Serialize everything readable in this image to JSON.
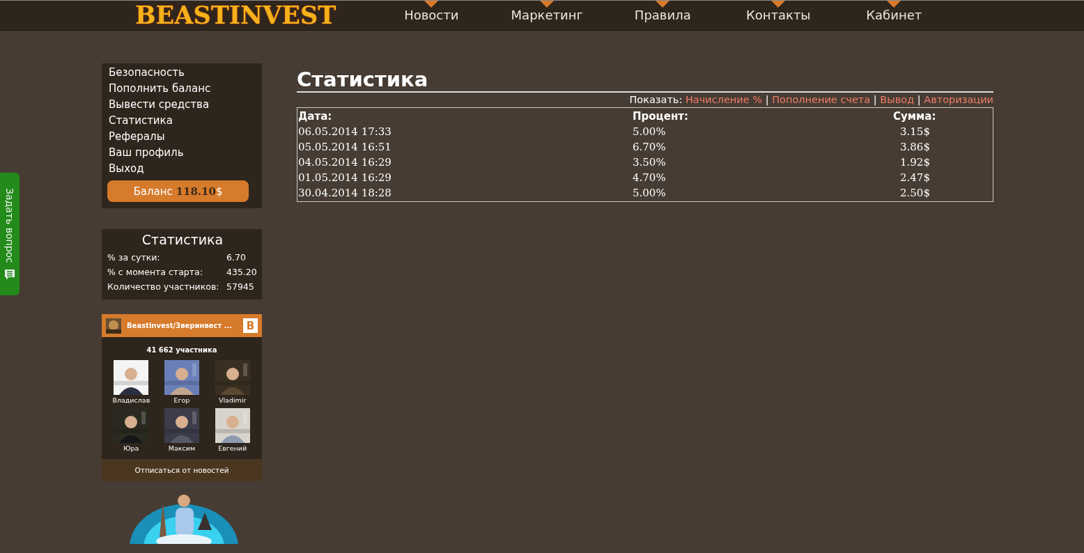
{
  "header": {
    "logo": "BEASTINVEST",
    "nav": [
      {
        "label": "Новости"
      },
      {
        "label": "Маркетинг"
      },
      {
        "label": "Правила"
      },
      {
        "label": "Контакты"
      },
      {
        "label": "Кабинет"
      }
    ]
  },
  "side_tab": {
    "label": "Задать вопрос"
  },
  "account_menu": {
    "items": [
      "Безопасность",
      "Пополнить баланс",
      "Вывести средства",
      "Статистика",
      "Рефералы",
      "Ваш профиль",
      "Выход"
    ],
    "balance_label": "Баланс",
    "balance_value": "118.10",
    "balance_currency": "$"
  },
  "stats_box": {
    "title": "Статистика",
    "rows": [
      {
        "label": "% за сутки:",
        "value": "6.70"
      },
      {
        "label": "% с момента старта:",
        "value": "435.20"
      },
      {
        "label": "Количество участников:",
        "value": "57945"
      }
    ]
  },
  "vk_widget": {
    "group_name": "Beastinvest/Зверинвест ...",
    "badge": "В",
    "members_count": "41 662 участника",
    "members": [
      {
        "name": "Владислав"
      },
      {
        "name": "Егор"
      },
      {
        "name": "Vladimir"
      },
      {
        "name": "Юра"
      },
      {
        "name": "Максим"
      },
      {
        "name": "Евгений"
      }
    ],
    "unsubscribe": "Отписаться от новостей"
  },
  "main": {
    "title": "Статистика",
    "filter_label": "Показать:",
    "filters": [
      "Начисление %",
      "Пополнение счета",
      "Вывод",
      "Авторизации"
    ],
    "separator": "|",
    "table": {
      "columns": [
        "Дата:",
        "Процент:",
        "Сумма:"
      ],
      "rows": [
        [
          "06.05.2014 17:33",
          "5.00%",
          "3.15$"
        ],
        [
          "05.05.2014 16:51",
          "6.70%",
          "3.86$"
        ],
        [
          "04.05.2014 16:29",
          "3.50%",
          "1.92$"
        ],
        [
          "01.05.2014 16:29",
          "4.70%",
          "2.47$"
        ],
        [
          "30.04.2014 18:28",
          "5.00%",
          "2.50$"
        ]
      ]
    }
  }
}
